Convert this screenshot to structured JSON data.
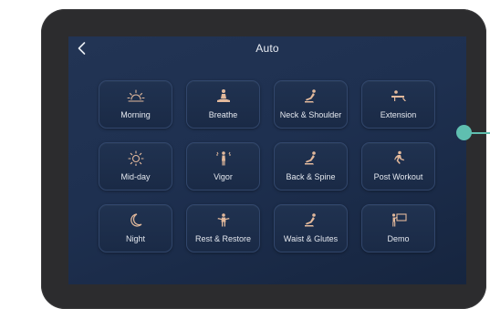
{
  "header": {
    "title": "Auto",
    "back_icon": "chevron-left-icon"
  },
  "programs": [
    {
      "label": "Morning",
      "icon": "sunrise-icon"
    },
    {
      "label": "Breathe",
      "icon": "meditation-icon"
    },
    {
      "label": "Neck & Shoulder",
      "icon": "recline-neck-icon"
    },
    {
      "label": "Extension",
      "icon": "stretch-icon"
    },
    {
      "label": "Mid-day",
      "icon": "sun-icon"
    },
    {
      "label": "Vigor",
      "icon": "energy-person-icon"
    },
    {
      "label": "Back & Spine",
      "icon": "recline-back-icon"
    },
    {
      "label": "Post Workout",
      "icon": "running-icon"
    },
    {
      "label": "Night",
      "icon": "moon-icon"
    },
    {
      "label": "Rest & Restore",
      "icon": "relax-person-icon"
    },
    {
      "label": "Waist & Glutes",
      "icon": "recline-waist-icon"
    },
    {
      "label": "Demo",
      "icon": "presentation-icon"
    }
  ],
  "colors": {
    "accent": "#e2b99c",
    "screen_bg": "#1e3050",
    "tile_bg": "#1c2c48",
    "callout": "#5fbfb0",
    "bezel": "#2c2c2e"
  }
}
